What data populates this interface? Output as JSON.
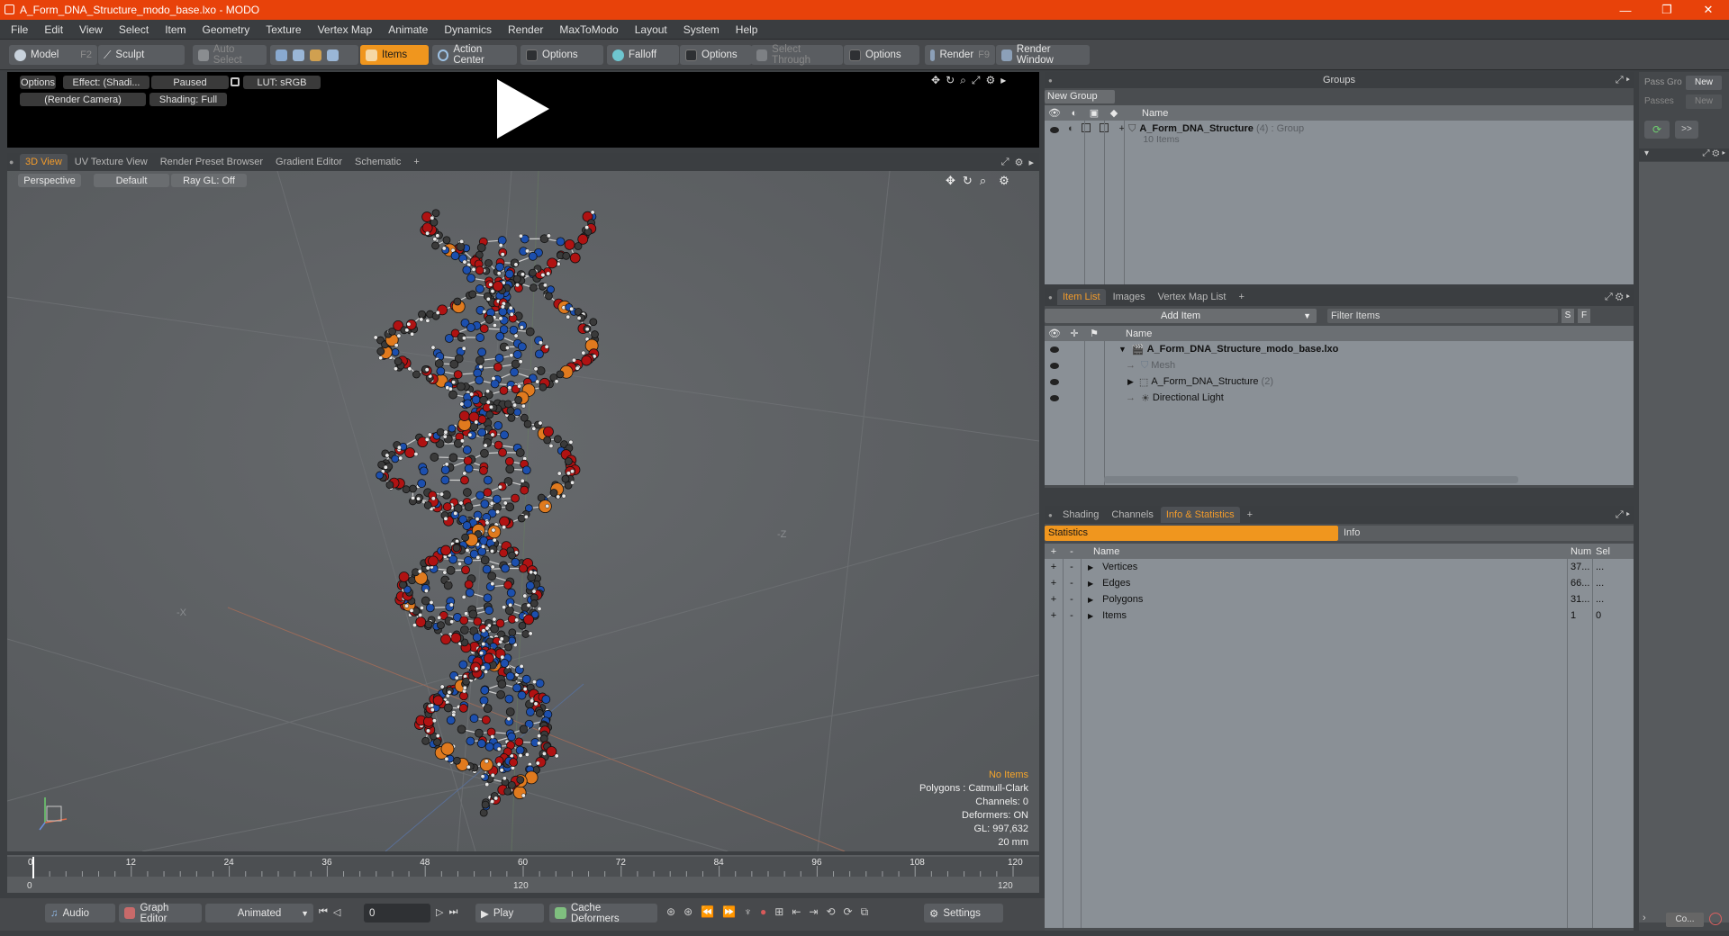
{
  "window": {
    "title": "A_Form_DNA_Structure_modo_base.lxo - MODO",
    "controls": [
      "—",
      "❐",
      "✕"
    ]
  },
  "menu": [
    "File",
    "Edit",
    "View",
    "Select",
    "Item",
    "Geometry",
    "Texture",
    "Vertex Map",
    "Animate",
    "Dynamics",
    "Render",
    "MaxToModo",
    "Layout",
    "System",
    "Help"
  ],
  "toolbar": {
    "model": "Model",
    "model_key": "F2",
    "sculpt": "Sculpt",
    "auto_select": "Auto Select",
    "items": "Items",
    "action_center": "Action Center",
    "options1": "Options",
    "falloff": "Falloff",
    "options2": "Options",
    "select_through": "Select Through",
    "options3": "Options",
    "render": "Render",
    "render_key": "F9",
    "render_window": "Render Window"
  },
  "preview": {
    "options": "Options",
    "effect": "Effect: (Shadi...",
    "paused": "Paused",
    "lut": "LUT: sRGB",
    "camera": "(Render Camera)",
    "shading": "Shading: Full"
  },
  "viewport_tabs": [
    "3D View",
    "UV Texture View",
    "Render Preset Browser",
    "Gradient Editor",
    "Schematic",
    "+"
  ],
  "viewport": {
    "perspective": "Perspective",
    "default": "Default",
    "raygl": "Ray GL: Off",
    "axis_z": "-Z",
    "axis_x": "-X",
    "info": {
      "no_items": "No Items",
      "polygons": "Polygons : Catmull-Clark",
      "channels": "Channels: 0",
      "deformers": "Deformers: ON",
      "gl": "GL: 997,632",
      "scale": "20 mm"
    }
  },
  "timeline": {
    "ticks": [
      "0",
      "12",
      "24",
      "36",
      "48",
      "60",
      "72",
      "84",
      "96",
      "108",
      "120"
    ],
    "lower": {
      "start": "0",
      "mid": "120",
      "end": "120"
    }
  },
  "bottom": {
    "audio": "Audio",
    "graph_editor": "Graph Editor",
    "animated": "Animated",
    "frame": "0",
    "play": "Play",
    "cache_deformers": "Cache Deformers",
    "settings": "Settings"
  },
  "groups": {
    "title": "Groups",
    "new_group": "New Group",
    "col_name": "Name",
    "item_name": "A_Form_DNA_Structure",
    "item_count": "(4)",
    "item_type": ": Group",
    "item_sub": "10 Items"
  },
  "pass": {
    "pass_gro": "Pass Gro",
    "new": "New",
    "passes": "Passes",
    "new2": "New",
    "arrow": ">>"
  },
  "item_list": {
    "tabs": [
      "Item List",
      "Images",
      "Vertex Map List",
      "+"
    ],
    "add_item": "Add Item",
    "filter": "Filter Items",
    "s": "S",
    "f": "F",
    "col_name": "Name",
    "rows": [
      {
        "name": "A_Form_DNA_Structure_modo_base.lxo"
      },
      {
        "name": "Mesh"
      },
      {
        "name": "A_Form_DNA_Structure",
        "count": "(2)"
      },
      {
        "name": "Directional Light"
      }
    ]
  },
  "stats": {
    "tabs": [
      "Shading",
      "Channels",
      "Info & Statistics",
      "+"
    ],
    "statistics": "Statistics",
    "info": "Info",
    "col_name": "Name",
    "col_num": "Num",
    "col_sel": "Sel",
    "rows": [
      {
        "name": "Vertices",
        "num": "37...",
        "sel": "..."
      },
      {
        "name": "Edges",
        "num": "66...",
        "sel": "..."
      },
      {
        "name": "Polygons",
        "num": "31...",
        "sel": "..."
      },
      {
        "name": "Items",
        "num": "1",
        "sel": "0"
      }
    ]
  },
  "right_strip": {
    "co": "Co..."
  },
  "colors": {
    "accent": "#f0961e",
    "title_bar": "#e8420a",
    "oxygen": "#b01212",
    "nitrogen": "#1c4fae",
    "phosphorus": "#e07a1e",
    "carbon": "#3a3a3a"
  }
}
